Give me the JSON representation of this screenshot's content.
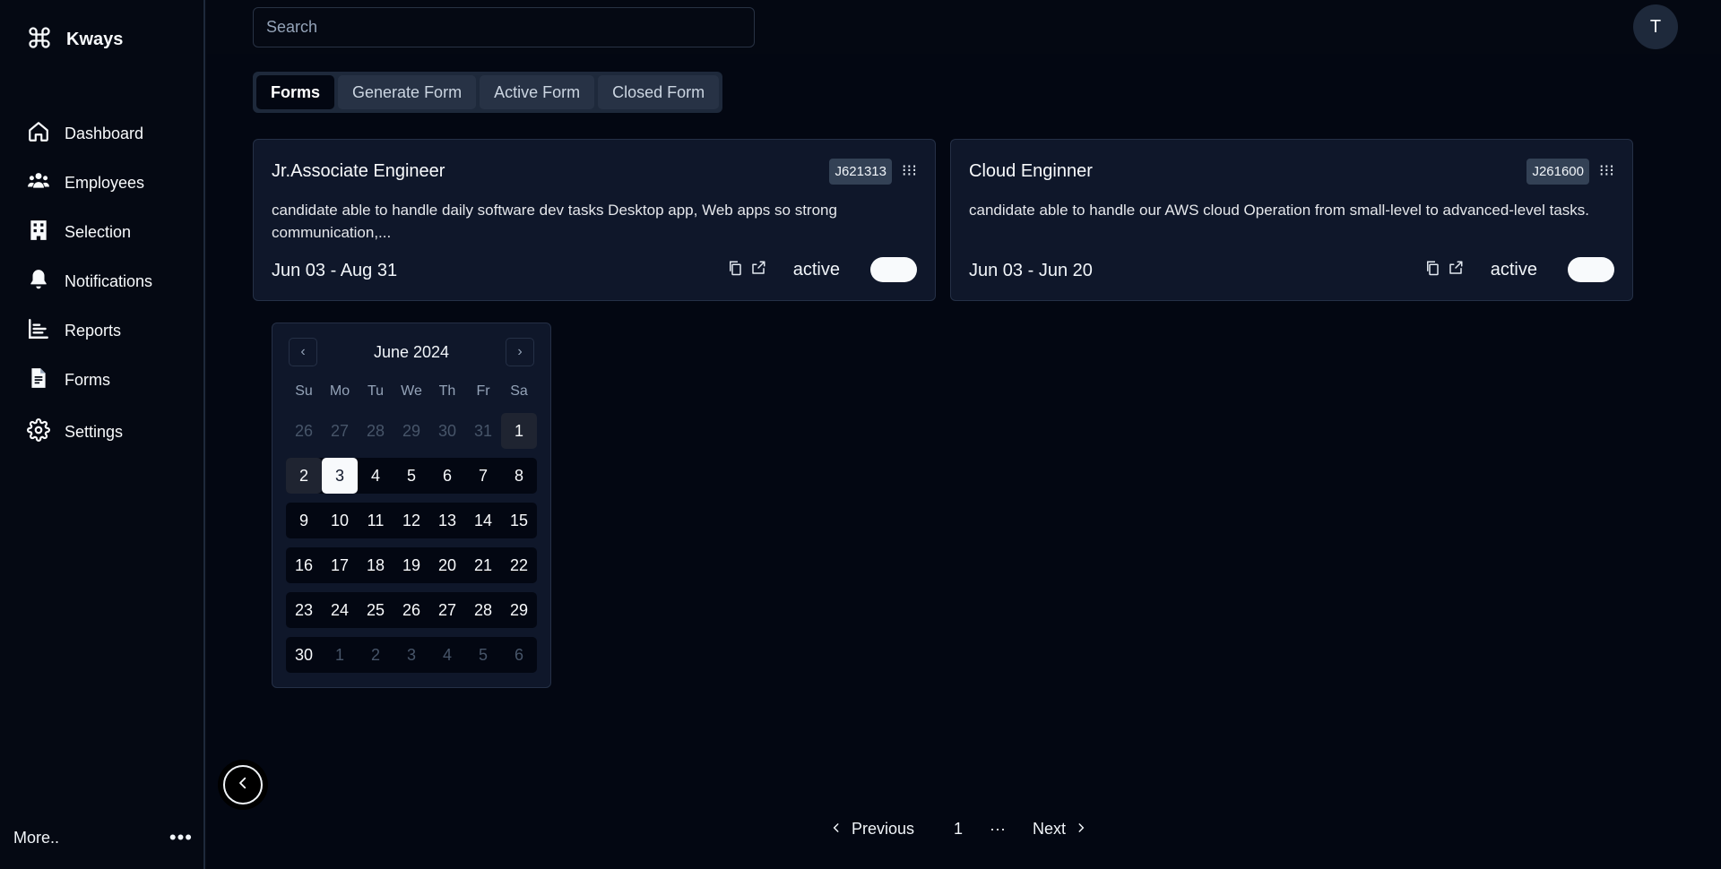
{
  "app": {
    "name": "Kways"
  },
  "sidebar": {
    "items": [
      {
        "label": "Dashboard",
        "icon": "home-icon"
      },
      {
        "label": "Employees",
        "icon": "users-icon"
      },
      {
        "label": "Selection",
        "icon": "building-icon"
      },
      {
        "label": "Notifications",
        "icon": "bell-icon"
      },
      {
        "label": "Reports",
        "icon": "bar-chart-icon"
      },
      {
        "label": "Forms",
        "icon": "file-text-icon"
      },
      {
        "label": "Settings",
        "icon": "gear-icon"
      }
    ],
    "more_label": "More..",
    "more_icon": "ellipsis-icon"
  },
  "header": {
    "search_placeholder": "Search",
    "avatar_initial": "T"
  },
  "tabs": [
    {
      "label": "Forms",
      "active": true
    },
    {
      "label": "Generate Form",
      "active": false
    },
    {
      "label": "Active Form",
      "active": false
    },
    {
      "label": "Closed Form",
      "active": false
    }
  ],
  "cards": [
    {
      "title": "Jr.Associate Engineer",
      "code": "J621313",
      "description": "candidate able to handle daily software dev tasks Desktop app, Web apps so strong communication,...",
      "date_range": "Jun 03 - Aug 31",
      "status": "active",
      "toggle_on": true
    },
    {
      "title": "Cloud Enginner",
      "code": "J261600",
      "description": "candidate able to handle our AWS cloud Operation from small-level to advanced-level tasks.",
      "date_range": "Jun 03 - Jun 20",
      "status": "active",
      "toggle_on": true
    }
  ],
  "calendar": {
    "title": "June 2024",
    "weekdays": [
      "Su",
      "Mo",
      "Tu",
      "We",
      "Th",
      "Fr",
      "Sa"
    ],
    "weeks": [
      [
        "26",
        "27",
        "28",
        "29",
        "30",
        "31",
        "1"
      ],
      [
        "2",
        "3",
        "4",
        "5",
        "6",
        "7",
        "8"
      ],
      [
        "9",
        "10",
        "11",
        "12",
        "13",
        "14",
        "15"
      ],
      [
        "16",
        "17",
        "18",
        "19",
        "20",
        "21",
        "22"
      ],
      [
        "23",
        "24",
        "25",
        "26",
        "27",
        "28",
        "29"
      ],
      [
        "30",
        "1",
        "2",
        "3",
        "4",
        "5",
        "6"
      ]
    ],
    "selected": "3"
  },
  "pagination": {
    "previous_label": "Previous",
    "current_page": "1",
    "ellipsis": "···",
    "next_label": "Next"
  }
}
